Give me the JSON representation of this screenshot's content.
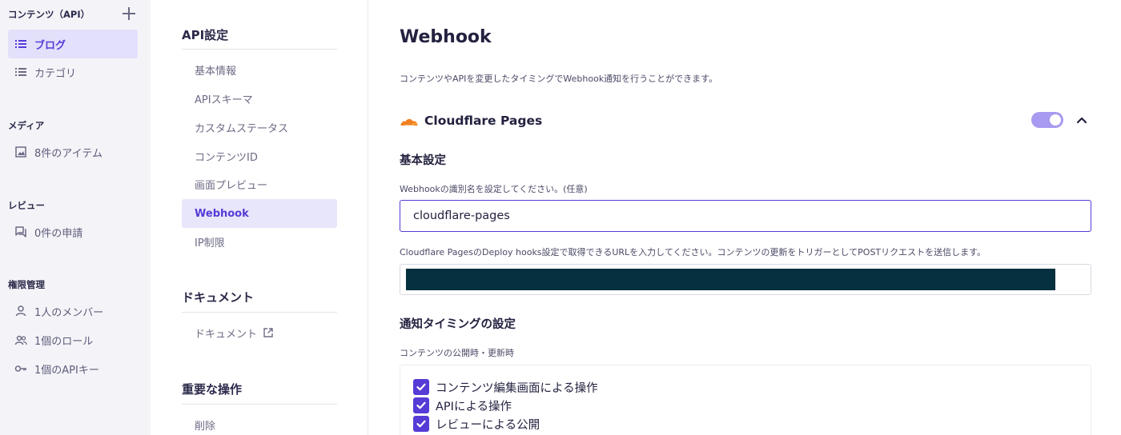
{
  "sidebar": {
    "content_header": "コンテンツ（API）",
    "items_content": [
      {
        "label": "ブログ",
        "icon": "list-icon",
        "active": true
      },
      {
        "label": "カテゴリ",
        "icon": "list-icon",
        "active": false
      }
    ],
    "media_header": "メディア",
    "media_item": {
      "label": "8件のアイテム",
      "icon": "image-icon"
    },
    "review_header": "レビュー",
    "review_item": {
      "label": "0件の申請",
      "icon": "chat-icon"
    },
    "permission_header": "権限管理",
    "permission_items": [
      {
        "label": "1人のメンバー",
        "icon": "person-icon"
      },
      {
        "label": "1個のロール",
        "icon": "people-icon"
      },
      {
        "label": "1個のAPIキー",
        "icon": "key-icon"
      }
    ]
  },
  "settings_nav": {
    "api_section": "API設定",
    "api_items": [
      "基本情報",
      "APIスキーマ",
      "カスタムステータス",
      "コンテンツID",
      "画面プレビュー",
      "Webhook",
      "IP制限"
    ],
    "active_item": "Webhook",
    "doc_section": "ドキュメント",
    "doc_item": "ドキュメント",
    "danger_section": "重要な操作",
    "danger_item": "削除"
  },
  "main": {
    "title": "Webhook",
    "description": "コンテンツやAPIを変更したタイミングでWebhook通知を行うことができます。",
    "integration_name": "Cloudflare Pages",
    "integration_enabled": true,
    "basic_settings_title": "基本設定",
    "name_label": "Webhookの識別名を設定してください。(任意)",
    "name_value": "cloudflare-pages",
    "url_label": "Cloudflare PagesのDeploy hooks設定で取得できるURLを入力してください。コンテンツの更新をトリガーとしてPOSTリクエストを送信します。",
    "timing_title": "通知タイミングの設定",
    "timing_label": "コンテンツの公開時・更新時",
    "timing_options": [
      {
        "label": "コンテンツ編集画面による操作",
        "checked": true
      },
      {
        "label": "APIによる操作",
        "checked": true
      },
      {
        "label": "レビューによる公開",
        "checked": true
      }
    ]
  },
  "colors": {
    "accent": "#563bd6",
    "accent_light": "#e3e0fb",
    "toggle_on": "#a79af0",
    "cloudflare_orange": "#f38020",
    "redaction": "#04303f"
  }
}
